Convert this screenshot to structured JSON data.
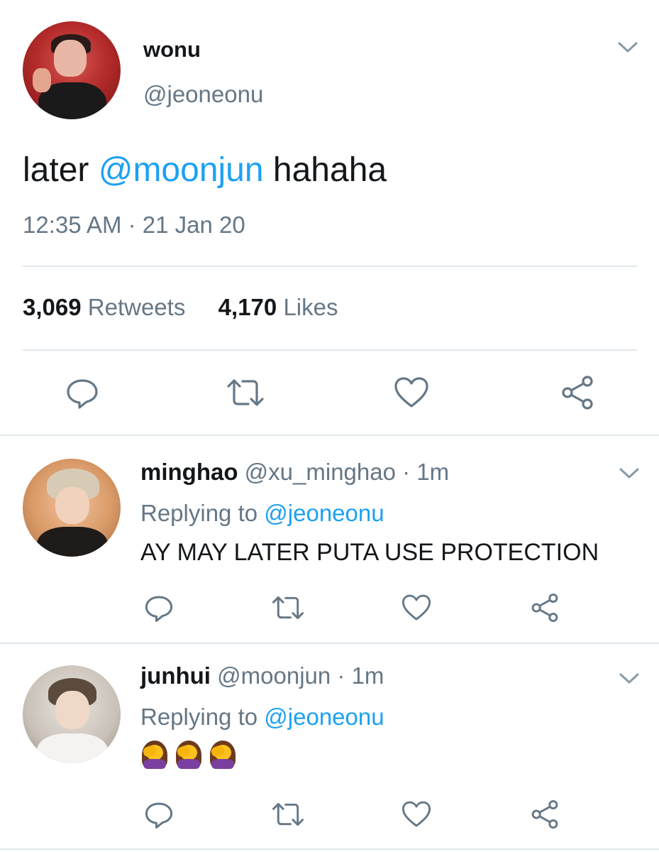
{
  "main_tweet": {
    "author_name": "wonu",
    "author_handle": "@jeoneonu",
    "text_before": "later ",
    "text_mention": "@moonjun",
    "text_after": " hahaha",
    "timestamp": "12:35 AM · 21 Jan 20",
    "retweet_count": "3,069",
    "retweet_label": "Retweets",
    "like_count": "4,170",
    "like_label": "Likes"
  },
  "replies": [
    {
      "author_name": "minghao",
      "author_handle": "@xu_minghao",
      "time": "· 1m",
      "replying_label": "Replying to",
      "replying_handle": "@jeoneonu",
      "text": "AY MAY LATER PUTA USE PROTECTION",
      "emoji": []
    },
    {
      "author_name": "junhui",
      "author_handle": "@moonjun",
      "time": "· 1m",
      "replying_label": "Replying to",
      "replying_handle": "@jeoneonu",
      "text": "",
      "emoji": [
        "woman-facepalming",
        "woman-facepalming",
        "woman-facepalming"
      ]
    }
  ],
  "icons": {
    "reply": "reply-icon",
    "retweet": "retweet-icon",
    "like": "heart-icon",
    "share": "share-icon",
    "more": "chevron-down-icon"
  },
  "colors": {
    "text_primary": "#14171a",
    "text_secondary": "#657786",
    "mention": "#1da1f2",
    "divider": "#e1e8ed",
    "icon": "#657786"
  }
}
